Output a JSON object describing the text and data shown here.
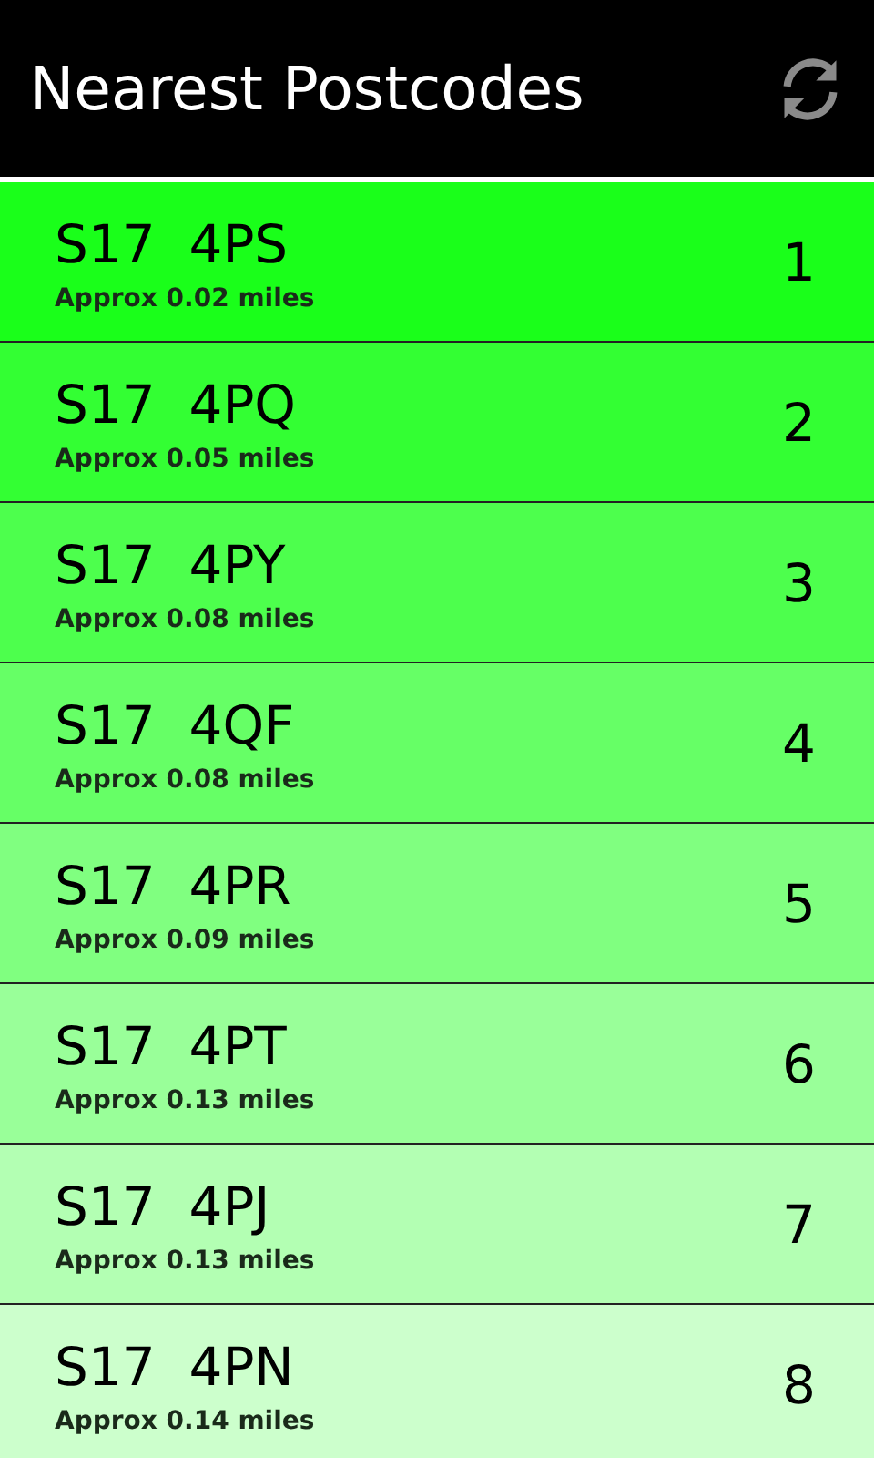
{
  "header": {
    "title": "Nearest Postcodes"
  },
  "postcodes": [
    {
      "postcode": "S17  4PS",
      "distance": "Approx 0.02 miles",
      "rank": "1",
      "color": "#1aff1a"
    },
    {
      "postcode": "S17  4PQ",
      "distance": "Approx 0.05 miles",
      "rank": "2",
      "color": "#33ff33"
    },
    {
      "postcode": "S17  4PY",
      "distance": "Approx 0.08 miles",
      "rank": "3",
      "color": "#4dff4d"
    },
    {
      "postcode": "S17  4QF",
      "distance": "Approx 0.08 miles",
      "rank": "4",
      "color": "#66ff66"
    },
    {
      "postcode": "S17  4PR",
      "distance": "Approx 0.09 miles",
      "rank": "5",
      "color": "#80ff80"
    },
    {
      "postcode": "S17  4PT",
      "distance": "Approx 0.13 miles",
      "rank": "6",
      "color": "#99ff99"
    },
    {
      "postcode": "S17  4PJ",
      "distance": "Approx 0.13 miles",
      "rank": "7",
      "color": "#b3ffb3"
    },
    {
      "postcode": "S17  4PN",
      "distance": "Approx 0.14 miles",
      "rank": "8",
      "color": "#ccffcc"
    }
  ]
}
